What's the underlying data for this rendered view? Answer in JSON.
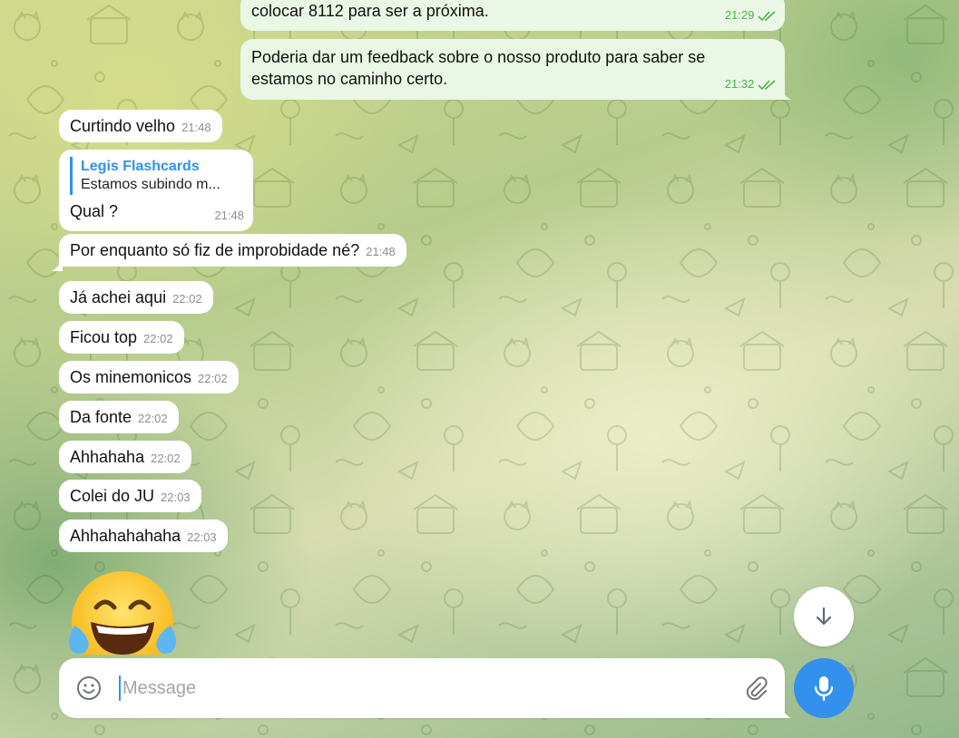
{
  "messages_out": [
    {
      "text": "colocar 8112 para ser a próxima.",
      "time": "21:29"
    },
    {
      "line1": "Poderia dar um feedback sobre o nosso produto para saber se",
      "line2": "estamos no caminho certo.",
      "time": "21:32"
    }
  ],
  "messages_in": [
    {
      "text": "Curtindo velho",
      "time": "21:48"
    },
    {
      "reply_name": "Legis Flashcards",
      "reply_text": "Estamos subindo m...",
      "text": "Qual ?",
      "time": "21:48"
    },
    {
      "text": "Por enquanto só fiz de improbidade né?",
      "time": "21:48"
    },
    {
      "text": "Já achei aqui",
      "time": "22:02"
    },
    {
      "text": "Ficou top",
      "time": "22:02"
    },
    {
      "text": "Os minemonicos",
      "time": "22:02"
    },
    {
      "text": "Da fonte",
      "time": "22:02"
    },
    {
      "text": "Ahhahaha",
      "time": "22:02"
    },
    {
      "text": "Colei do JU",
      "time": "22:03"
    },
    {
      "text": "Ahhahahahaha",
      "time": "22:03"
    }
  ],
  "emoji_message": {
    "emoji": "😂",
    "icon": "face-with-tears-of-joy"
  },
  "composer": {
    "placeholder": "Message"
  },
  "icons": {
    "emoji": "smile-icon",
    "attach": "paperclip-icon",
    "mic": "microphone-icon",
    "scroll": "arrow-down-icon"
  },
  "colors": {
    "accent": "#3390ec",
    "outgoing_bubble": "#eaf7e4",
    "incoming_bubble": "#ffffff",
    "read_check": "#4fae4e"
  }
}
